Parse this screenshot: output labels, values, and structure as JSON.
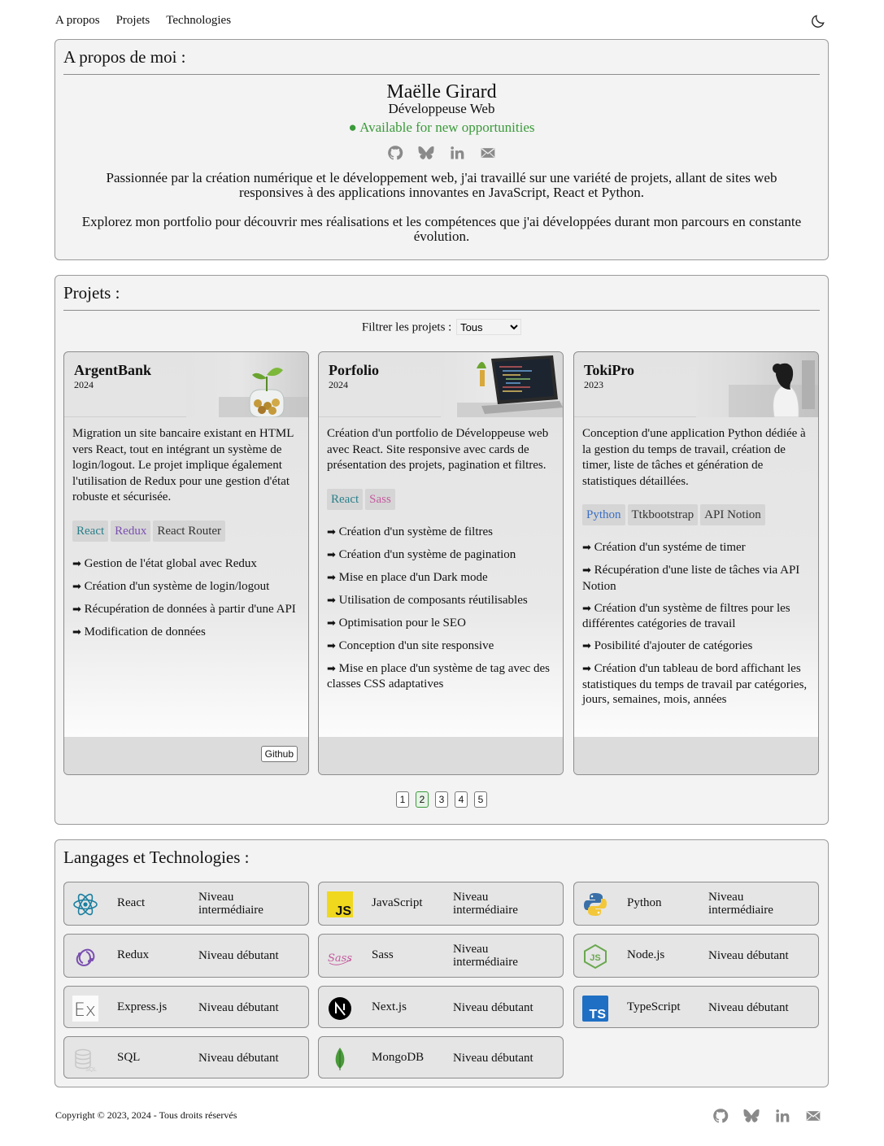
{
  "nav": {
    "items": [
      "A propos",
      "Projets",
      "Technologies"
    ],
    "theme_icon": "moon-icon"
  },
  "about": {
    "heading": "A propos de moi :",
    "name": "Maëlle Girard",
    "role": "Développeuse Web",
    "availability": "● Available for new opportunities",
    "availability_color": "#3a9a3a",
    "social_icons": [
      "github-icon",
      "bluesky-icon",
      "linkedin-icon",
      "mail-icon"
    ],
    "bio": [
      "Passionnée par la création numérique et le développement web, j'ai travaillé sur une variété de projets, allant de sites web responsives à des applications innovantes en JavaScript, React et Python.",
      "Explorez mon portfolio pour découvrir mes réalisations et les compétences que j'ai développées durant mon parcours en constante évolution."
    ]
  },
  "projects": {
    "heading": "Projets :",
    "filter_label": "Filtrer les projets :",
    "filter_value": "Tous",
    "cards": [
      {
        "title": "ArgentBank",
        "year": "2024",
        "image": "plant-coins-image",
        "description": "Migration un site bancaire existant en HTML vers React, tout en intégrant un système de login/logout. Le projet implique également l'utilisation de Redux pour une gestion d'état robuste et sécurisée.",
        "tags": [
          {
            "label": "React",
            "color": "#2a7f8a"
          },
          {
            "label": "Redux",
            "color": "#7a4fb0"
          },
          {
            "label": "React Router",
            "color": "#333333"
          }
        ],
        "features": [
          "Gestion de l'état global avec Redux",
          "Création d'un système de login/logout",
          "Récupération de données à partir d'une API",
          "Modification de données"
        ],
        "github_label": "Github"
      },
      {
        "title": "Porfolio",
        "year": "2024",
        "image": "laptop-code-image",
        "description": "Création d'un portfolio de Développeuse web avec React. Site responsive avec cards de présentation des projets, pagination et filtres.",
        "tags": [
          {
            "label": "React",
            "color": "#2a7f8a"
          },
          {
            "label": "Sass",
            "color": "#c45a9e"
          }
        ],
        "features": [
          "Création d'un système de filtres",
          "Création d'un système de pagination",
          "Mise en place d'un Dark mode",
          "Utilisation de composants réutilisables",
          "Optimisation pour le SEO",
          "Conception d'un site responsive",
          "Mise en place d'un système de tag avec des classes CSS adaptatives"
        ]
      },
      {
        "title": "TokiPro",
        "year": "2023",
        "image": "woman-working-image",
        "description": "Conception d'une application Python dédiée à la gestion du temps de travail, création de timer, liste de tâches et génération de statistiques détaillées.",
        "tags": [
          {
            "label": "Python",
            "color": "#3a6fc4"
          },
          {
            "label": "Ttkbootstrap",
            "color": "#333333"
          },
          {
            "label": "API Notion",
            "color": "#333333"
          }
        ],
        "features": [
          "Création d'un systéme de timer",
          "Récupération d'une liste de tâches via API Notion",
          "Création d'un système de filtres pour les différentes catégories de travail",
          "Posibilité d'ajouter de catégories",
          "Création d'un tableau de bord affichant les statistiques du temps de travail par catégories, jours, semaines, mois, années"
        ]
      }
    ],
    "pages": [
      "1",
      "2",
      "3",
      "4",
      "5"
    ],
    "current_page": "2"
  },
  "tech": {
    "heading": "Langages et Technologies :",
    "items": [
      {
        "name": "React",
        "level": "Niveau intermédiaire",
        "icon": "react-icon"
      },
      {
        "name": "JavaScript",
        "level": "Niveau intermédiaire",
        "icon": "javascript-icon"
      },
      {
        "name": "Python",
        "level": "Niveau intermédiaire",
        "icon": "python-icon"
      },
      {
        "name": "Redux",
        "level": "Niveau débutant",
        "icon": "redux-icon"
      },
      {
        "name": "Sass",
        "level": "Niveau intermédiaire",
        "icon": "sass-icon"
      },
      {
        "name": "Node.js",
        "level": "Niveau débutant",
        "icon": "nodejs-icon"
      },
      {
        "name": "Express.js",
        "level": "Niveau débutant",
        "icon": "express-icon"
      },
      {
        "name": "Next.js",
        "level": "Niveau débutant",
        "icon": "nextjs-icon"
      },
      {
        "name": "TypeScript",
        "level": "Niveau débutant",
        "icon": "typescript-icon"
      },
      {
        "name": "SQL",
        "level": "Niveau débutant",
        "icon": "sql-icon"
      },
      {
        "name": "MongoDB",
        "level": "Niveau débutant",
        "icon": "mongodb-icon"
      }
    ]
  },
  "footer": {
    "copyright": "Copyright © 2023, 2024 - Tous droits réservés",
    "social_icons": [
      "github-icon",
      "bluesky-icon",
      "linkedin-icon",
      "mail-icon"
    ]
  }
}
